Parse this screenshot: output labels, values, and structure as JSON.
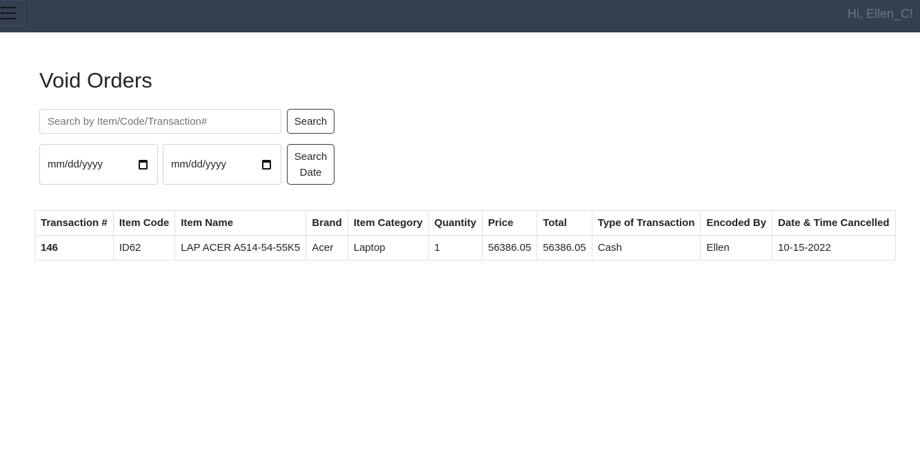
{
  "navbar": {
    "greeting": "Hi, Ellen_C!"
  },
  "page": {
    "title": "Void Orders"
  },
  "search": {
    "placeholder": "Search by Item/Code/Transaction#",
    "value": "",
    "button_label": "Search"
  },
  "date_filter": {
    "start_placeholder": "mm/dd/yyyy",
    "end_placeholder": "mm/dd/yyyy",
    "button_line1": "Search",
    "button_line2": "Date"
  },
  "table": {
    "headers": [
      "Transaction #",
      "Item Code",
      "Item Name",
      "Brand",
      "Item Category",
      "Quantity",
      "Price",
      "Total",
      "Type of Transaction",
      "Encoded By",
      "Date & Time Cancelled"
    ],
    "rows": [
      [
        "146",
        "ID62",
        "LAP ACER A514-54-55K5",
        "Acer",
        "Laptop",
        "1",
        "56386.05",
        "56386.05",
        "Cash",
        "Ellen",
        "10-15-2022"
      ]
    ]
  },
  "colors": {
    "navbar_bg": "#343f51",
    "greeting_text": "#6c7687"
  },
  "icons": {
    "menu": "hamburger-menu-icon",
    "calendar": "calendar-icon"
  }
}
